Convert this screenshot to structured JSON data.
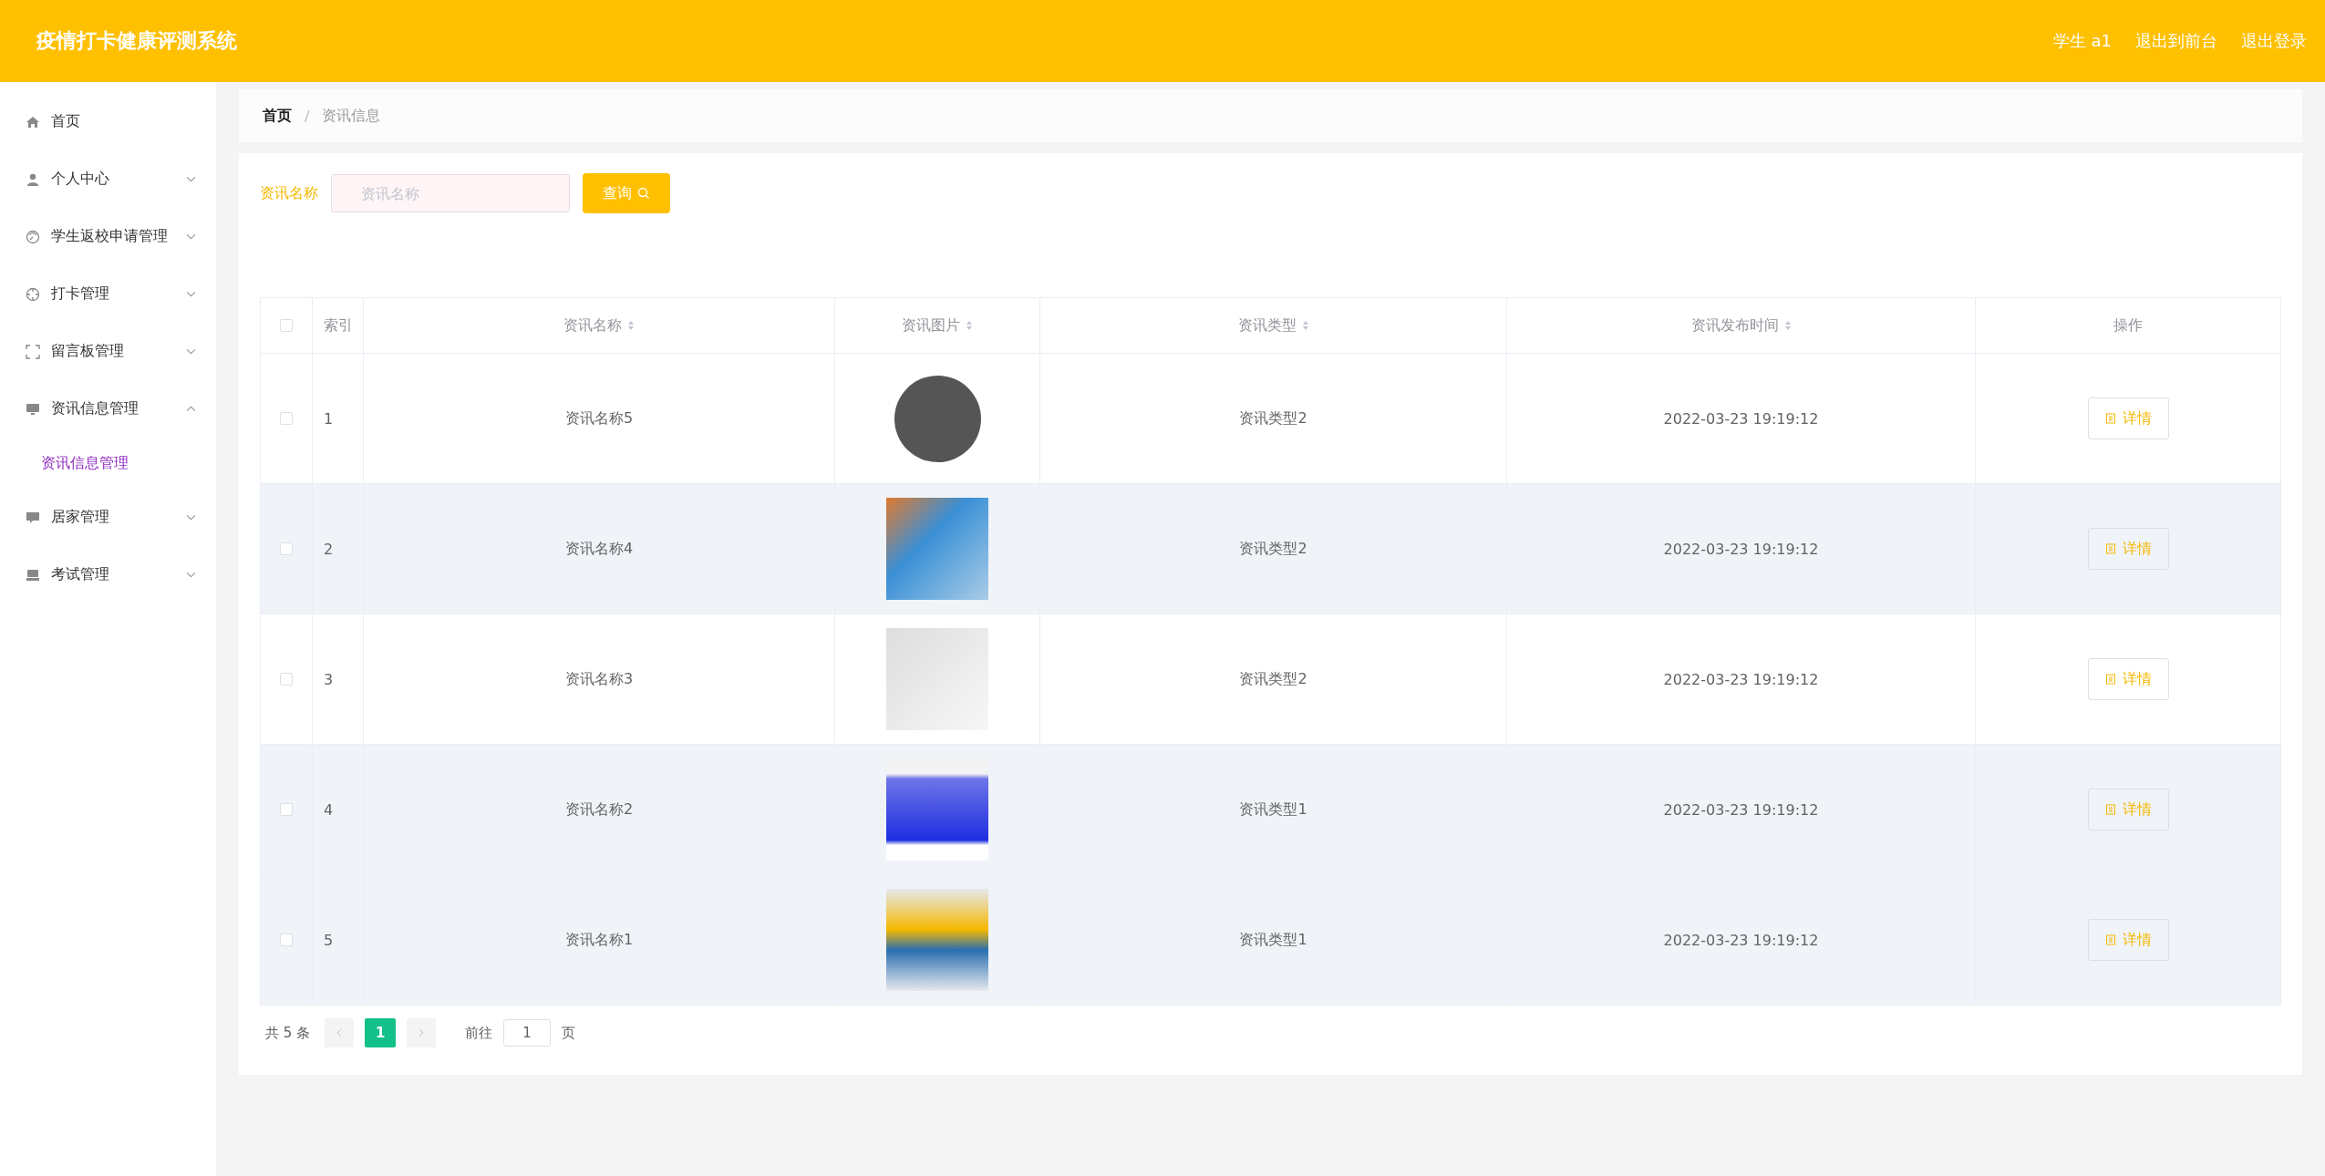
{
  "header": {
    "title": "疫情打卡健康评测系统",
    "links": [
      "学生 a1",
      "退出到前台",
      "退出登录"
    ]
  },
  "sidebar": {
    "items": [
      {
        "label": "首页"
      },
      {
        "label": "个人中心",
        "expanded": false
      },
      {
        "label": "学生返校申请管理",
        "expanded": false
      },
      {
        "label": "打卡管理",
        "expanded": false
      },
      {
        "label": "留言板管理",
        "expanded": false
      },
      {
        "label": "资讯信息管理",
        "expanded": true,
        "children": [
          {
            "label": "资讯信息管理",
            "selected": true
          }
        ]
      },
      {
        "label": "居家管理",
        "expanded": false
      },
      {
        "label": "考试管理",
        "expanded": false
      }
    ]
  },
  "breadcrumb": {
    "items": [
      "首页",
      "资讯信息"
    ],
    "separator": "/"
  },
  "search": {
    "label": "资讯名称",
    "placeholder": "资讯名称",
    "button": "查询"
  },
  "table": {
    "select_all_checked": false,
    "columns": [
      {
        "label": "索引",
        "sortable": false
      },
      {
        "label": "资讯名称",
        "sortable": true
      },
      {
        "label": "资讯图片",
        "sortable": true
      },
      {
        "label": "资讯类型",
        "sortable": true
      },
      {
        "label": "资讯发布时间",
        "sortable": true
      },
      {
        "label": "操作",
        "sortable": false
      }
    ],
    "rows": [
      {
        "index": "1",
        "name": "资讯名称5",
        "type": "资讯类型2",
        "time": "2022-03-23 19:19:12",
        "action": "详情",
        "checked": false,
        "highlighted": false
      },
      {
        "index": "2",
        "name": "资讯名称4",
        "type": "资讯类型2",
        "time": "2022-03-23 19:19:12",
        "action": "详情",
        "checked": false,
        "highlighted": true
      },
      {
        "index": "3",
        "name": "资讯名称3",
        "type": "资讯类型2",
        "time": "2022-03-23 19:19:12",
        "action": "详情",
        "checked": false,
        "highlighted": false
      },
      {
        "index": "4",
        "name": "资讯名称2",
        "type": "资讯类型1",
        "time": "2022-03-23 19:19:12",
        "action": "详情",
        "checked": false,
        "highlighted": true
      },
      {
        "index": "5",
        "name": "资讯名称1",
        "type": "资讯类型1",
        "time": "2022-03-23 19:19:12",
        "action": "详情",
        "checked": false,
        "highlighted": true
      }
    ]
  },
  "pagination": {
    "total": "共 5 条",
    "pages": [
      {
        "label": "1",
        "selected": true
      }
    ],
    "goto_label": "前往",
    "goto_value": "1",
    "page_suffix": "页"
  }
}
